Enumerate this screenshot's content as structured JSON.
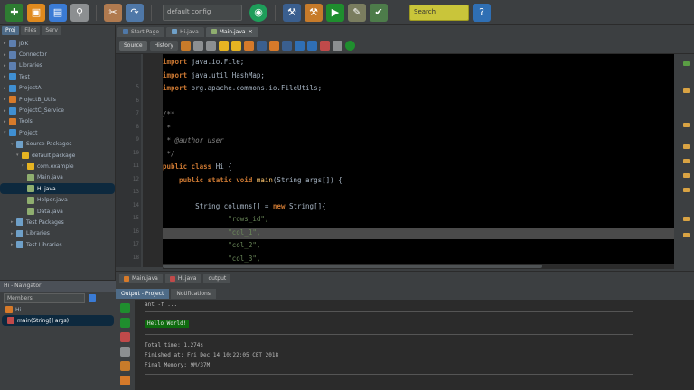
{
  "toolbar": {
    "config_value": "default config",
    "search_label": "Search"
  },
  "project": {
    "tabs": [
      "Proj",
      "Files",
      "Serv"
    ],
    "items": [
      {
        "label": "JDK"
      },
      {
        "label": "Connector"
      },
      {
        "label": "Libraries"
      },
      {
        "label": "Test"
      },
      {
        "label": "ProjectA"
      },
      {
        "label": "ProjectB_Utils"
      },
      {
        "label": "ProjectC_Service"
      },
      {
        "label": "Tools"
      },
      {
        "label": "Project"
      },
      {
        "label": "Source Packages"
      },
      {
        "label": "default package"
      },
      {
        "label": "com.example"
      },
      {
        "label": "Main.java"
      },
      {
        "label": "Hi.java"
      },
      {
        "label": "Helper.java"
      },
      {
        "label": "Data.java"
      },
      {
        "label": "Test Packages"
      },
      {
        "label": "Libraries"
      },
      {
        "label": "Test Libraries"
      }
    ]
  },
  "navigator": {
    "title": "Hi - Navigator",
    "filter_label": "Members",
    "items": [
      {
        "label": "Hi"
      },
      {
        "label": "main(String[] args)"
      }
    ]
  },
  "editor": {
    "tabs": [
      {
        "label": "Start Page"
      },
      {
        "label": "Hi.java"
      },
      {
        "label": "Main.java"
      }
    ],
    "modes": [
      "Source",
      "History"
    ],
    "line_numbers": [
      "5",
      "6",
      "7",
      "8",
      "9",
      "10",
      "11",
      "12",
      "13",
      "14",
      "15",
      "16",
      "17",
      "18"
    ],
    "lines": [
      {
        "spans": [
          {
            "t": "import",
            "c": "kw"
          },
          {
            "t": " java.io.File;",
            "c": "plain"
          }
        ]
      },
      {
        "spans": [
          {
            "t": "import",
            "c": "kw"
          },
          {
            "t": " java.util.HashMap;",
            "c": "plain"
          }
        ]
      },
      {
        "spans": [
          {
            "t": "import",
            "c": "kw"
          },
          {
            "t": " org.apache.commons.io.FileUtils;",
            "c": "plain"
          }
        ]
      },
      {
        "spans": []
      },
      {
        "spans": [
          {
            "t": "/**",
            "c": "cmt"
          }
        ]
      },
      {
        "spans": [
          {
            "t": " *",
            "c": "cmt"
          }
        ]
      },
      {
        "spans": [
          {
            "t": " * @author user",
            "c": "cmt"
          }
        ]
      },
      {
        "spans": [
          {
            "t": " */",
            "c": "cmt"
          }
        ]
      },
      {
        "spans": [
          {
            "t": "public class",
            "c": "kw"
          },
          {
            "t": " Hi {",
            "c": "plain"
          }
        ]
      },
      {
        "spans": [
          {
            "t": "    public static void ",
            "c": "kw"
          },
          {
            "t": "main",
            "c": "fn"
          },
          {
            "t": "(String args[]) {",
            "c": "plain"
          }
        ]
      },
      {
        "spans": []
      },
      {
        "spans": [
          {
            "t": "        String columns[] = ",
            "c": "plain"
          },
          {
            "t": "new",
            "c": "kw"
          },
          {
            "t": " String[]{",
            "c": "plain"
          }
        ]
      },
      {
        "spans": [
          {
            "t": "                \"rows_id\",",
            "c": "str"
          }
        ]
      },
      {
        "spans": [
          {
            "t": "                \"col_1\",",
            "c": "str"
          }
        ]
      },
      {
        "spans": [
          {
            "t": "                \"col_2\",",
            "c": "str"
          }
        ]
      },
      {
        "spans": [
          {
            "t": "                \"col_3\",",
            "c": "str"
          }
        ]
      }
    ]
  },
  "bottom": {
    "file_tabs": [
      "Main.java",
      "Hi.java",
      "output"
    ],
    "output_tabs": [
      "Output - Project",
      "Notifications"
    ],
    "lines": {
      "header": "ant -f ...",
      "build_label": "Hello World!",
      "total_time": "Total time: 1.274s",
      "finished": "Finished at: Fri Dec 14 10:22:05 CET 2018",
      "memory": "Final Memory: 9M/37M"
    }
  },
  "colors": {
    "accent": "#4e6b87",
    "keyword": "#cc7832",
    "string": "#6a8759",
    "comment": "#808080",
    "function": "#ffc66d",
    "highlight": "#4a4a4a"
  }
}
